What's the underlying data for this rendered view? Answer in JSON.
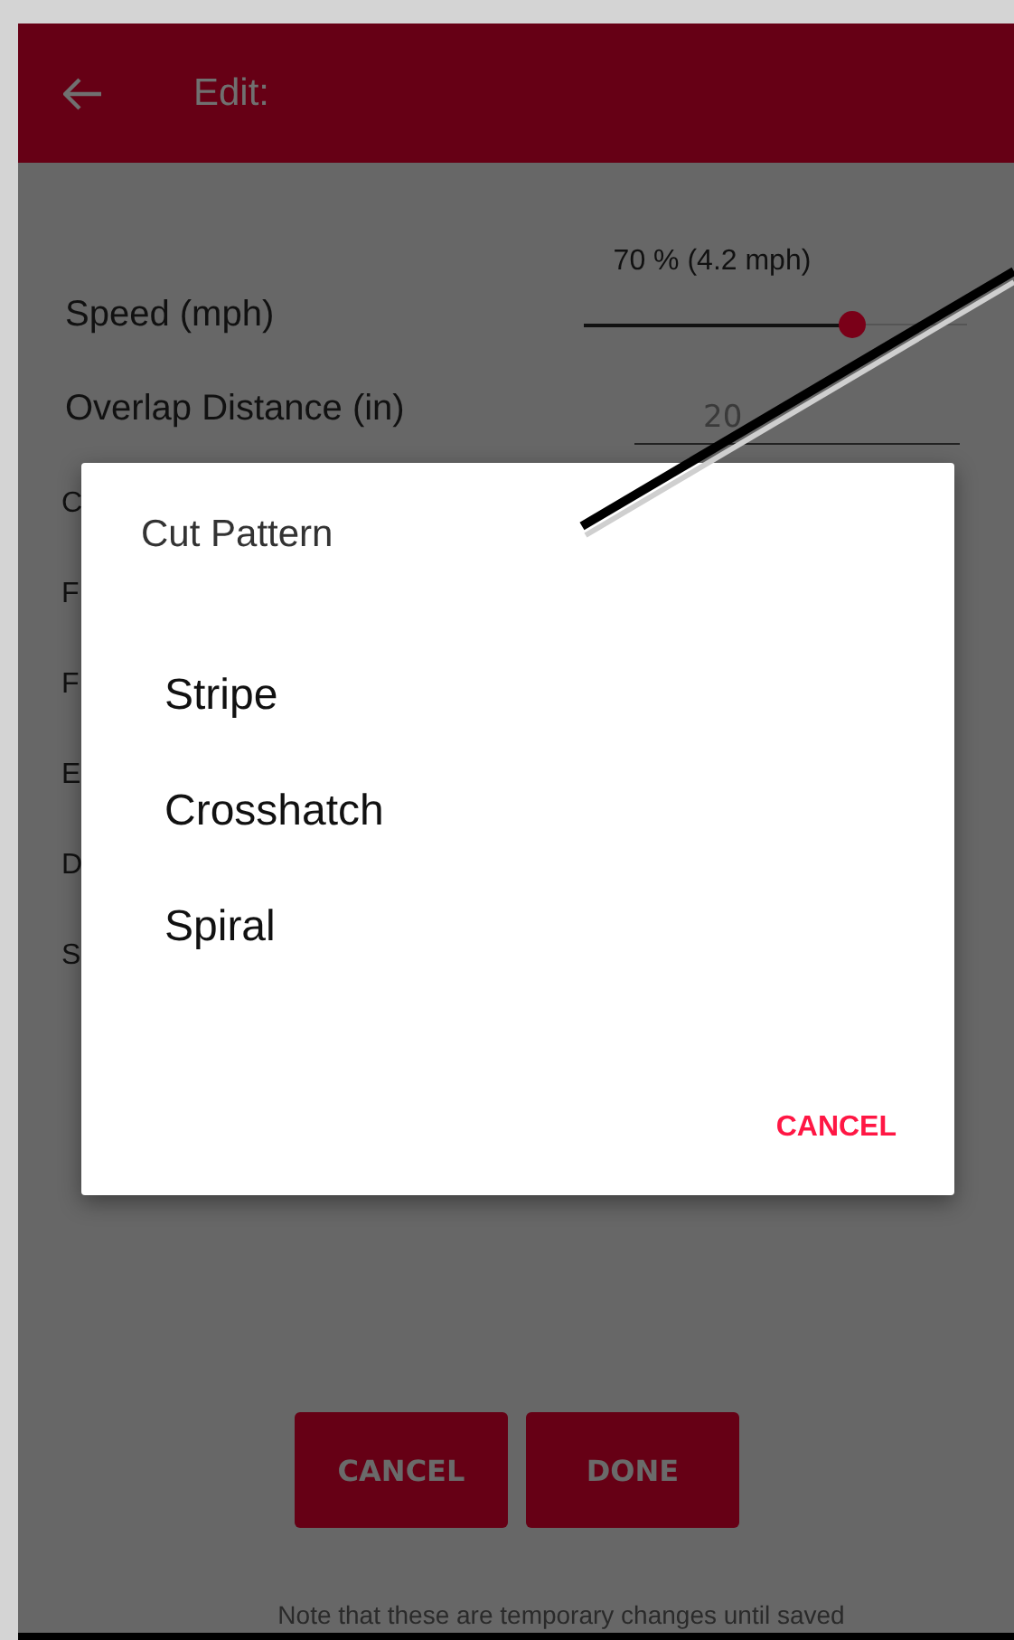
{
  "header": {
    "title": "Edit:"
  },
  "settings": [
    {
      "kind": "slider",
      "label": "Speed (mph)",
      "reading": "70 % (4.2 mph)",
      "level": 0.7
    },
    {
      "kind": "field",
      "label": "Overlap Distance (in)",
      "value": "20"
    },
    {
      "kind": "partial",
      "label": "C"
    },
    {
      "kind": "partial",
      "label": "F"
    },
    {
      "kind": "partial",
      "label": "F"
    },
    {
      "kind": "partial",
      "label": "E"
    },
    {
      "kind": "partial",
      "label": "D"
    },
    {
      "kind": "partial",
      "label": "S"
    }
  ],
  "buttons": [
    "CANCEL",
    "DONE"
  ],
  "note": "Note that these are temporary changes until saved",
  "dialog": {
    "title": "Cut Pattern",
    "options": [
      "Stripe",
      "Crosshatch",
      "Spiral"
    ],
    "cancel": "CANCEL"
  }
}
